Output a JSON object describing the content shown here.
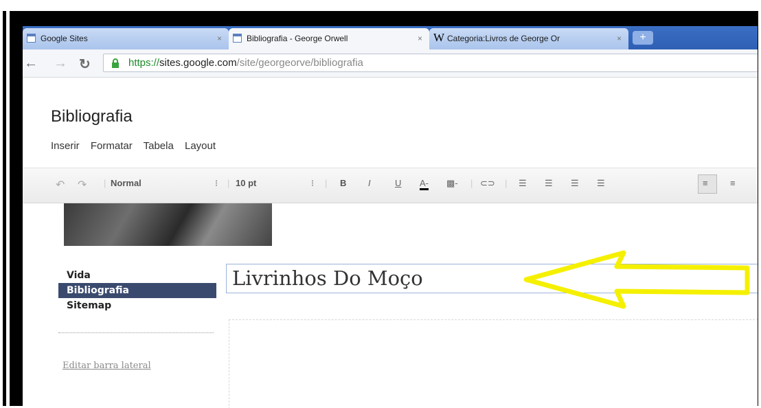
{
  "browser": {
    "tabs": [
      {
        "label": "Google Sites",
        "active": false
      },
      {
        "label": "Bibliografia - George Orwell",
        "active": true
      },
      {
        "label": "Categoria:Livros de George Or",
        "active": false
      }
    ],
    "new_tab_label": "+",
    "url": {
      "scheme": "https://",
      "host": "sites.google.com",
      "path": "/site/georgeorve/bibliografia"
    }
  },
  "page": {
    "title": "Bibliografia",
    "menu": [
      "Inserir",
      "Formatar",
      "Tabela",
      "Layout"
    ]
  },
  "editor_toolbar": {
    "style_select": "Normal",
    "size_select": "10 pt"
  },
  "sidebar": {
    "items": [
      {
        "label": "Vida",
        "active": false
      },
      {
        "label": "Bibliografia",
        "active": true
      },
      {
        "label": "Sitemap",
        "active": false
      }
    ],
    "edit_link": "Editar barra lateral"
  },
  "editor": {
    "title_value": "Livrinhos Do Moço"
  },
  "colors": {
    "arrow": "#f5f000",
    "sidebar_active": "#3a4a6e",
    "tabbar": "#3b6fc4"
  }
}
